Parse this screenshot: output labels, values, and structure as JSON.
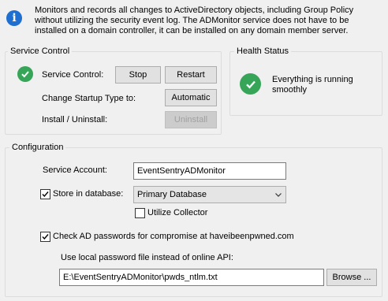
{
  "info": {
    "icon": "info-icon",
    "text": "Monitors and records all changes to ActiveDirectory objects, including Group Policy without utilizing the security event log. The ADMonitor service does not have to be installed on a domain controller, it can be installed on any domain member server."
  },
  "service_control": {
    "title": "Service Control",
    "status_icon": "check-circle-icon",
    "service_control_label": "Service Control:",
    "stop_label": "Stop",
    "restart_label": "Restart",
    "startup_type_label": "Change Startup Type to:",
    "automatic_label": "Automatic",
    "install_label": "Install / Uninstall:",
    "uninstall_label": "Uninstall"
  },
  "health_status": {
    "title": "Health Status",
    "status_icon": "check-circle-icon",
    "status_text": "Everything is running smoothly"
  },
  "configuration": {
    "title": "Configuration",
    "service_account_label": "Service Account:",
    "service_account_value": "EventSentryADMonitor",
    "store_in_database_label": "Store in database:",
    "store_in_database_checked": true,
    "database_selected": "Primary Database",
    "utilize_collector_label": "Utilize Collector",
    "utilize_collector_checked": false,
    "check_ad_passwords_label": "Check AD passwords for compromise at haveibeenpwned.com",
    "check_ad_passwords_checked": true,
    "local_password_file_label": "Use local password file instead of online API:",
    "local_password_file_value": "E:\\EventSentryADMonitor\\pwds_ntlm.txt",
    "browse_label": "Browse ..."
  },
  "colors": {
    "accent_info": "#1e6fd0",
    "status_green": "#37a558",
    "background": "#f0f0f0"
  }
}
